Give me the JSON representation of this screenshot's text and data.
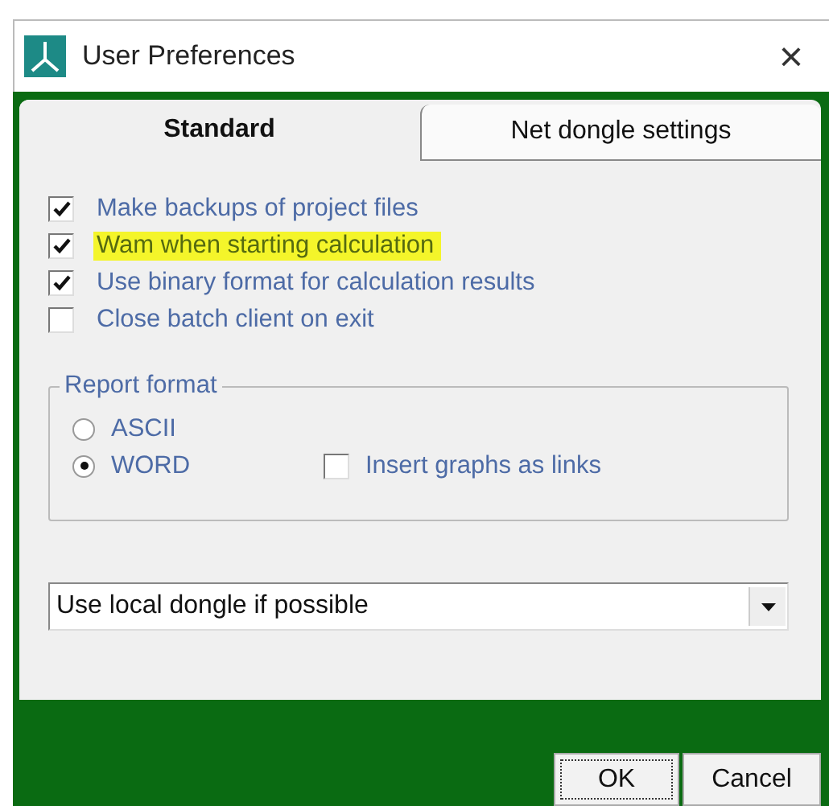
{
  "window": {
    "title": "User Preferences",
    "close": "×"
  },
  "tabs": [
    {
      "label": "Standard",
      "selected": true
    },
    {
      "label": "Net dongle settings",
      "selected": false
    }
  ],
  "options": [
    {
      "label": "Make backups of project files",
      "checked": true,
      "highlighted": false
    },
    {
      "label": "Wam when starting calculation",
      "checked": true,
      "highlighted": true
    },
    {
      "label": "Use binary format for calculation results",
      "checked": true,
      "highlighted": false
    },
    {
      "label": "Close batch client on exit",
      "checked": false,
      "highlighted": false
    }
  ],
  "report_format": {
    "title": "Report format",
    "radios": [
      {
        "label": "ASCII",
        "selected": false
      },
      {
        "label": "WORD",
        "selected": true
      }
    ],
    "insert_graphs": {
      "label": "Insert graphs as links",
      "checked": false
    }
  },
  "dongle_select": {
    "value": "Use local dongle if possible"
  },
  "buttons": [
    {
      "label": "OK",
      "default": true
    },
    {
      "label": "Cancel",
      "default": false
    }
  ]
}
